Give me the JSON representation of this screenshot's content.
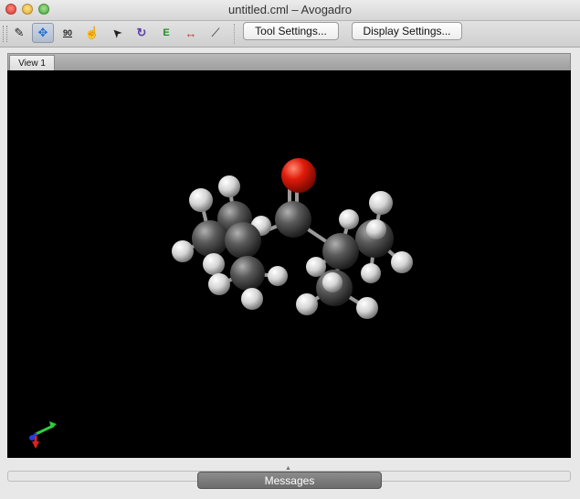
{
  "window": {
    "title": "untitled.cml – Avogadro"
  },
  "toolbar": {
    "tools": [
      {
        "name": "draw-tool",
        "glyph": "✎"
      },
      {
        "name": "navigate-tool",
        "glyph": "✥"
      },
      {
        "name": "bond-centric-tool",
        "glyph": "90"
      },
      {
        "name": "manipulate-tool",
        "glyph": "☝"
      },
      {
        "name": "select-tool",
        "glyph": "➤"
      },
      {
        "name": "auto-rotate-tool",
        "glyph": "↻"
      },
      {
        "name": "auto-optimize-tool",
        "glyph": "E"
      },
      {
        "name": "measure-tool",
        "glyph": "↔"
      },
      {
        "name": "align-tool",
        "glyph": "⟋"
      }
    ],
    "tool_settings_label": "Tool Settings...",
    "display_settings_label": "Display Settings..."
  },
  "tabs": [
    {
      "label": "View 1"
    }
  ],
  "messages": {
    "label": "Messages"
  },
  "colors": {
    "viewport_bg": "#000000",
    "oxygen": "#e01b0b",
    "carbon": "#4e4e4e",
    "hydrogen": "#e4e4e4"
  }
}
